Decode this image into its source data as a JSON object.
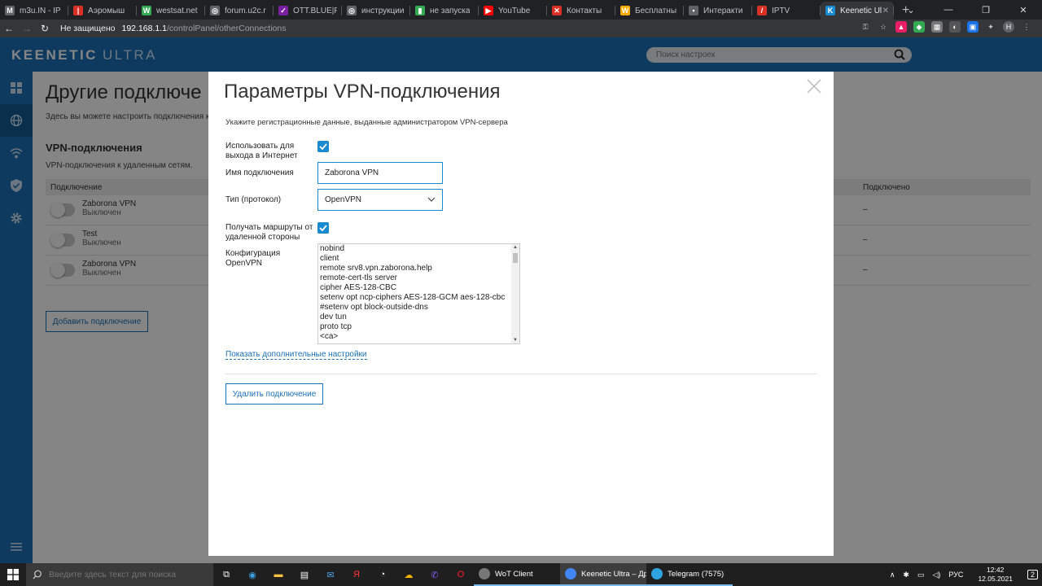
{
  "browser": {
    "tabs": [
      {
        "title": "m3u.IN - IP",
        "fav": "M",
        "color": "#5f6368"
      },
      {
        "title": "Аэромыш",
        "fav": "|",
        "color": "#d93025"
      },
      {
        "title": "westsat.net",
        "fav": "W",
        "color": "#34a853"
      },
      {
        "title": "forum.u2c.r",
        "fav": "◎",
        "color": "#5f6368"
      },
      {
        "title": "OTT.BLUE|P",
        "fav": "✓",
        "color": "#7b1fa2"
      },
      {
        "title": "инструкции",
        "fav": "◎",
        "color": "#5f6368"
      },
      {
        "title": "не запуска",
        "fav": "▮",
        "color": "#34a853"
      },
      {
        "title": "YouTube",
        "fav": "▶",
        "color": "#ff0000"
      },
      {
        "title": "Контакты",
        "fav": "✕",
        "color": "#d93025"
      },
      {
        "title": "Бесплатны",
        "fav": "W",
        "color": "#f9ab00"
      },
      {
        "title": "Интеракти",
        "fav": "▪",
        "color": "#5f6368"
      },
      {
        "title": "IPTV",
        "fav": "/",
        "color": "#d93025"
      },
      {
        "title": "Keenetic Ul",
        "fav": "K",
        "color": "#1a8bd0"
      }
    ],
    "new_tab": "+",
    "address": {
      "security": "Не защищено",
      "host": "192.168.1.1",
      "path": "/controlPanel/otherConnections"
    },
    "profile_initial": "Н"
  },
  "app": {
    "brand": "KEENETIC",
    "model": "ULTRA",
    "search_placeholder": "Поиск настроек"
  },
  "page": {
    "title": "Другие подключе",
    "description": "Здесь вы можете настроить подключения к ч",
    "section_title": "VPN-подключения",
    "section_sub": "VPN-подключения к удаленным сетям.",
    "col_connection": "Подключение",
    "col_connected": "Подключено",
    "rows": [
      {
        "name": "Zaborona VPN",
        "status": "Выключен",
        "connected": "–"
      },
      {
        "name": "Test",
        "status": "Выключен",
        "connected": "–"
      },
      {
        "name": "Zaborona VPN",
        "status": "Выключен",
        "connected": "–"
      }
    ],
    "add_button": "Добавить подключение"
  },
  "modal": {
    "title": "Параметры VPN-подключения",
    "intro": "Укажите регистрационные данные, выданные администратором VPN-сервера",
    "use_internet_label": "Использовать для выхода в Интернет",
    "use_internet_checked": true,
    "name_label": "Имя подключения",
    "name_value": "Zaborona VPN",
    "type_label": "Тип (протокол)",
    "type_value": "OpenVPN",
    "routes_label": "Получать маршруты от удаленной стороны",
    "routes_checked": true,
    "config_label": "Конфигурация OpenVPN",
    "config_lines": [
      "nobind",
      "client",
      "remote srv8.vpn.zaborona.help",
      "remote-cert-tls server",
      "cipher AES-128-CBC",
      "setenv opt ncp-ciphers AES-128-GCM aes-128-cbc",
      "#setenv opt block-outside-dns",
      "dev tun",
      "proto tcp",
      "<ca>"
    ],
    "more_settings": "Показать дополнительные настройки",
    "delete_button": "Удалить подключение"
  },
  "taskbar": {
    "search_placeholder": "Введите здесь текст для поиска",
    "apps": [
      {
        "title": "WoT Client",
        "color": "#777"
      },
      {
        "title": "Keenetic Ultra – Др...",
        "color": "#4285f4"
      },
      {
        "title": "Telegram (7575)",
        "color": "#2ca5e0"
      }
    ],
    "lang": "РУС",
    "time": "12:42",
    "date": "12.05.2021",
    "notif_count": "2"
  },
  "colors": {
    "brand_blue": "#1a6fb5",
    "accent": "#1a8bd0"
  }
}
